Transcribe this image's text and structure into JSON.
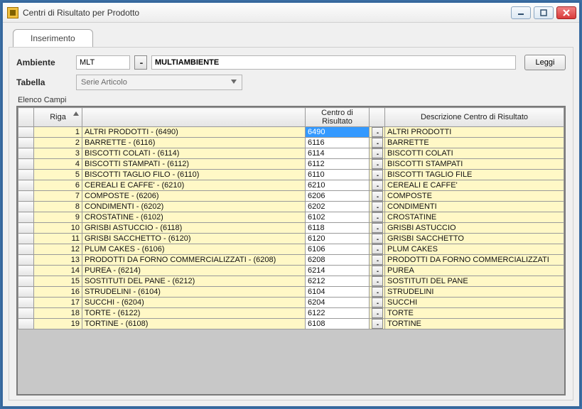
{
  "window": {
    "title": "Centri di Risultato per Prodotto"
  },
  "tab": {
    "label": "Inserimento"
  },
  "labels": {
    "ambiente": "Ambiente",
    "tabella": "Tabella",
    "elenco": "Elenco Campi"
  },
  "ambiente": {
    "code": "MLT",
    "desc": "MULTIAMBIENTE"
  },
  "buttons": {
    "leggi": "Leggi",
    "lookup": "..."
  },
  "tabella": {
    "selected": "Serie Articolo"
  },
  "grid": {
    "headers": {
      "riga": "Riga",
      "centro": "Centro di Risultato",
      "descr": "Descrizione Centro di Risultato"
    },
    "rows": [
      {
        "n": "1",
        "prod": "ALTRI PRODOTTI - (6490)",
        "cdr": "6490",
        "desc": "ALTRI PRODOTTI",
        "sel": true
      },
      {
        "n": "2",
        "prod": "BARRETTE - (6116)",
        "cdr": "6116",
        "desc": "BARRETTE"
      },
      {
        "n": "3",
        "prod": "BISCOTTI COLATI - (6114)",
        "cdr": "6114",
        "desc": "BISCOTTI COLATI"
      },
      {
        "n": "4",
        "prod": "BISCOTTI STAMPATI - (6112)",
        "cdr": "6112",
        "desc": "BISCOTTI STAMPATI"
      },
      {
        "n": "5",
        "prod": "BISCOTTI TAGLIO FILO - (6110)",
        "cdr": "6110",
        "desc": "BISCOTTI TAGLIO FILE"
      },
      {
        "n": "6",
        "prod": "CEREALI E CAFFE' - (6210)",
        "cdr": "6210",
        "desc": "CEREALI E CAFFE'"
      },
      {
        "n": "7",
        "prod": "COMPOSTE - (6206)",
        "cdr": "6206",
        "desc": "COMPOSTE"
      },
      {
        "n": "8",
        "prod": "CONDIMENTI - (6202)",
        "cdr": "6202",
        "desc": "CONDIMENTI"
      },
      {
        "n": "9",
        "prod": "CROSTATINE - (6102)",
        "cdr": "6102",
        "desc": "CROSTATINE"
      },
      {
        "n": "10",
        "prod": "GRISBI ASTUCCIO - (6118)",
        "cdr": "6118",
        "desc": "GRISBI ASTUCCIO"
      },
      {
        "n": "11",
        "prod": "GRISBI SACCHETTO - (6120)",
        "cdr": "6120",
        "desc": "GRISBI SACCHETTO"
      },
      {
        "n": "12",
        "prod": "PLUM CAKES - (6106)",
        "cdr": "6106",
        "desc": "PLUM CAKES"
      },
      {
        "n": "13",
        "prod": "PRODOTTI DA FORNO COMMERCIALIZZATI - (6208)",
        "cdr": "6208",
        "desc": "PRODOTTI DA FORNO COMMERCIALIZZATI"
      },
      {
        "n": "14",
        "prod": "PUREA - (6214)",
        "cdr": "6214",
        "desc": "PUREA"
      },
      {
        "n": "15",
        "prod": "SOSTITUTI DEL PANE - (6212)",
        "cdr": "6212",
        "desc": "SOSTITUTI DEL PANE"
      },
      {
        "n": "16",
        "prod": "STRUDELINI - (6104)",
        "cdr": "6104",
        "desc": "STRUDELINI"
      },
      {
        "n": "17",
        "prod": "SUCCHI - (6204)",
        "cdr": "6204",
        "desc": "SUCCHI"
      },
      {
        "n": "18",
        "prod": "TORTE - (6122)",
        "cdr": "6122",
        "desc": "TORTE"
      },
      {
        "n": "19",
        "prod": "TORTINE - (6108)",
        "cdr": "6108",
        "desc": "TORTINE"
      }
    ]
  }
}
